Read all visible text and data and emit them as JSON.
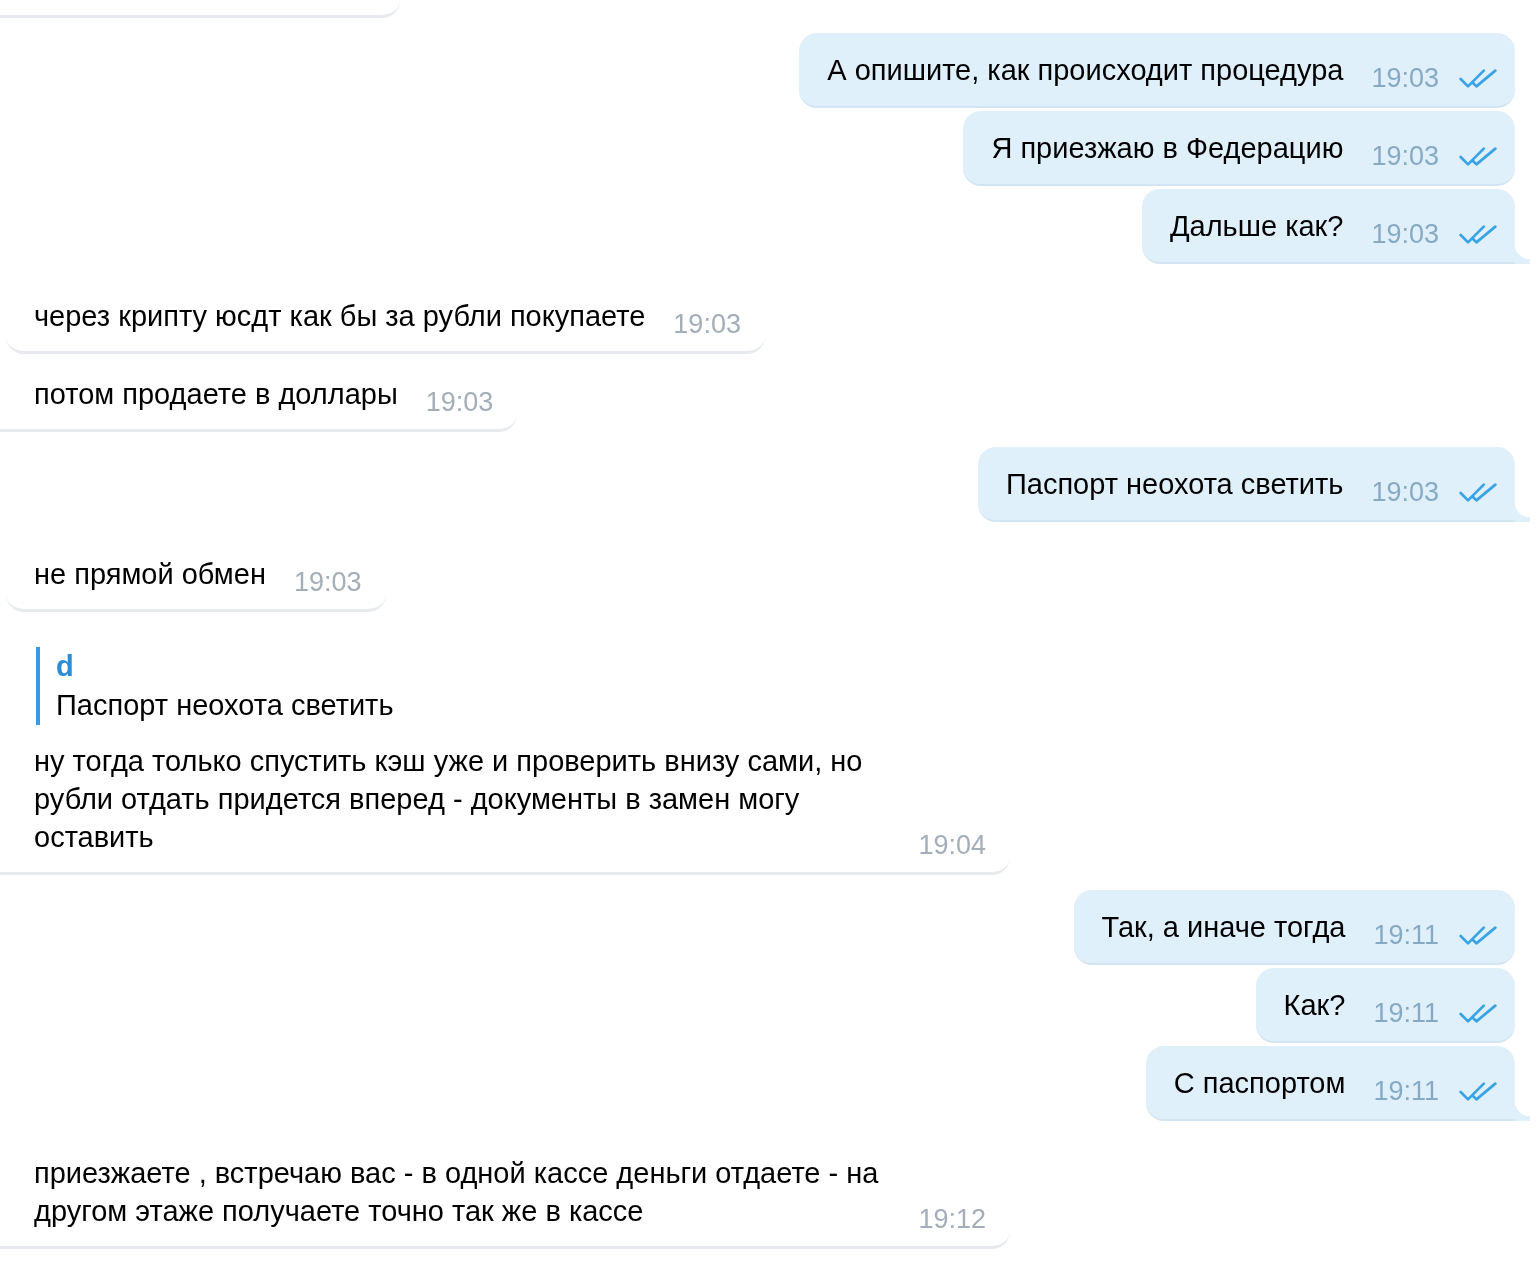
{
  "messages": [
    {
      "kind": "incoming",
      "cut_off": true
    },
    {
      "kind": "outgoing",
      "cut_off": false,
      "text": "А опишите, как происходит процедура",
      "time": "19:03",
      "read": true
    },
    {
      "kind": "outgoing",
      "cut_off": false,
      "text": "Я приезжаю в Федерацию",
      "time": "19:03",
      "read": true
    },
    {
      "kind": "outgoing",
      "cut_off": false,
      "text": "Дальше как?",
      "time": "19:03",
      "read": true
    },
    {
      "kind": "incoming",
      "cut_off": false,
      "text": "через крипту юсдт как бы за рубли покупаете",
      "time": "19:03"
    },
    {
      "kind": "incoming",
      "cut_off": false,
      "text": "потом продаете в доллары",
      "time": "19:03"
    },
    {
      "kind": "outgoing",
      "cut_off": false,
      "text": "Паспорт неохота светить",
      "time": "19:03",
      "read": true
    },
    {
      "kind": "incoming",
      "cut_off": false,
      "text": "не прямой обмен",
      "time": "19:03"
    },
    {
      "kind": "incoming",
      "cut_off": false,
      "reply": {
        "author": "d",
        "text": "Паспорт неохота светить"
      },
      "text": "ну тогда только спустить кэш уже и проверить внизу сами, но рубли отдать придется вперед - документы в замен могу оставить",
      "time": "19:04"
    },
    {
      "kind": "outgoing",
      "cut_off": false,
      "text": "Так, а иначе тогда",
      "time": "19:11",
      "read": true
    },
    {
      "kind": "outgoing",
      "cut_off": false,
      "text": "Как?",
      "time": "19:11",
      "read": true
    },
    {
      "kind": "outgoing",
      "cut_off": false,
      "text": "С паспортом",
      "time": "19:11",
      "read": true
    },
    {
      "kind": "incoming",
      "cut_off": false,
      "text": "приезжаете , встречаю вас - в одной кассе деньги отдаете - на другом этаже получаете точно так же в кассе",
      "time": "19:12"
    }
  ]
}
